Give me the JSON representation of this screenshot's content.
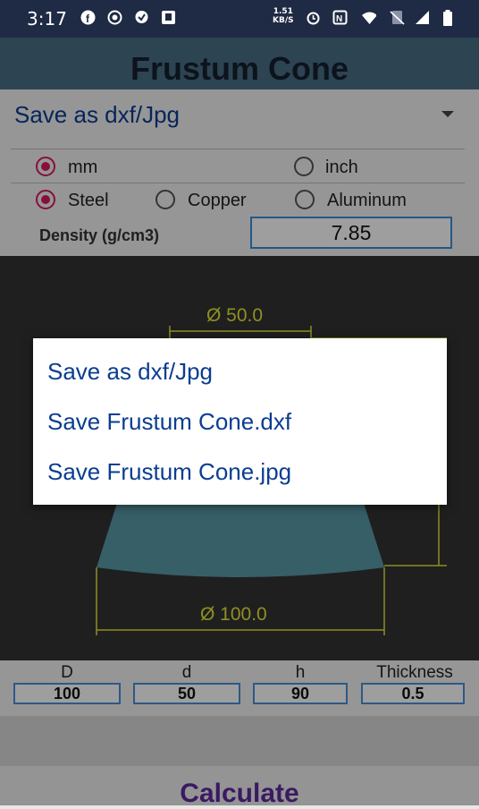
{
  "status_bar": {
    "time": "3:17",
    "speed_value": "1.51",
    "speed_unit": "KB/S"
  },
  "app": {
    "title": "Frustum Cone"
  },
  "spinner": {
    "selected": "Save as dxf/Jpg"
  },
  "units": {
    "mm_label": "mm",
    "inch_label": "inch",
    "selected": "mm"
  },
  "materials": {
    "steel_label": "Steel",
    "copper_label": "Copper",
    "aluminum_label": "Aluminum",
    "selected": "Steel"
  },
  "density": {
    "label": "Density (g/cm3)",
    "value": "7.85"
  },
  "drawing": {
    "top_dim": "Ø 50.0",
    "bottom_dim": "Ø 100.0",
    "fill_color": "#5a9aa8",
    "line_color": "#e6e639"
  },
  "inputs": [
    {
      "label": "D",
      "value": "100"
    },
    {
      "label": "d",
      "value": "50"
    },
    {
      "label": "h",
      "value": "90"
    },
    {
      "label": "Thickness",
      "value": "0.5"
    }
  ],
  "calculate_label": "Calculate",
  "menu": {
    "items": [
      "Save as dxf/Jpg",
      "Save Frustum Cone.dxf",
      "Save Frustum Cone.jpg"
    ]
  }
}
